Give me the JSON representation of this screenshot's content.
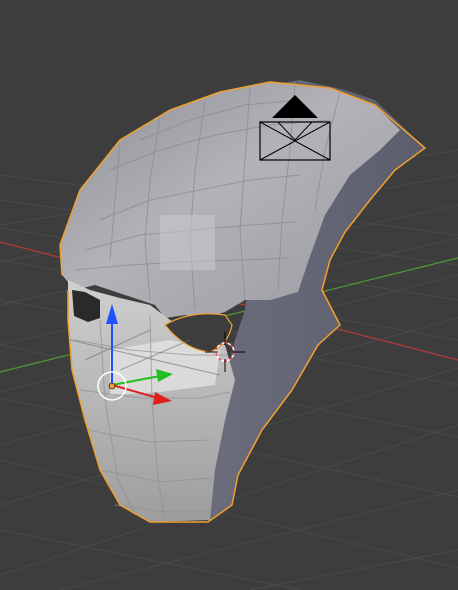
{
  "viewport": {
    "editor": "3D View",
    "background_color": "#3d3d3d",
    "grid_color": "#4a4a4a",
    "x_axis_color": "#b23b3b",
    "y_axis_color": "#4f9a30",
    "selection_outline_color": "#f0a030"
  },
  "scene": {
    "mesh": {
      "object": "mask-mesh",
      "selected": true,
      "shading": "solid"
    },
    "camera": {
      "object": "camera"
    },
    "manipulator": {
      "x_color": "#e02020",
      "y_color": "#20c020",
      "z_color": "#2050ff"
    },
    "cursor_3d": {
      "icon": "crosshair-icon"
    }
  }
}
